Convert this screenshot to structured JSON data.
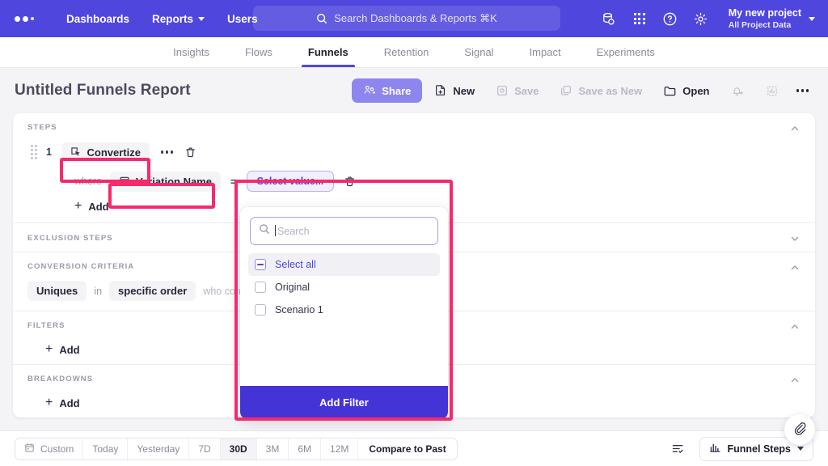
{
  "header": {
    "nav": [
      {
        "label": "Dashboards",
        "caret": false
      },
      {
        "label": "Reports",
        "caret": true
      },
      {
        "label": "Users",
        "caret": false
      }
    ],
    "search_placeholder": "Search Dashboards & Reports ⌘K",
    "icons": [
      "database-icon",
      "apps-grid-icon",
      "help-circle-icon",
      "gear-icon"
    ],
    "project_name": "My new project",
    "project_sub": "All Project Data"
  },
  "subtabs": [
    {
      "label": "Insights",
      "active": false
    },
    {
      "label": "Flows",
      "active": false
    },
    {
      "label": "Funnels",
      "active": true
    },
    {
      "label": "Retention",
      "active": false
    },
    {
      "label": "Signal",
      "active": false
    },
    {
      "label": "Impact",
      "active": false
    },
    {
      "label": "Experiments",
      "active": false
    }
  ],
  "title": {
    "text": "Untitled Funnels Report",
    "actions": {
      "share": "Share",
      "new": "New",
      "save": "Save",
      "save_as_new": "Save as New",
      "open": "Open"
    }
  },
  "panel": {
    "steps": {
      "label": "STEPS",
      "step_number": "1",
      "event_chip": "Convertize",
      "where_label": "where",
      "property_chip": "Variation Name",
      "operator": "=",
      "select_value": "Select value...",
      "add_label": "Add"
    },
    "exclusion_steps": {
      "label": "EXCLUSION STEPS"
    },
    "conversion_criteria": {
      "label": "CONVERSION CRITERIA",
      "counting": "Uniques",
      "in_word": "in",
      "order": "specific order",
      "tail": "who converted within"
    },
    "filters": {
      "label": "FILTERS",
      "add_label": "Add"
    },
    "breakdowns": {
      "label": "BREAKDOWNS",
      "add_label": "Add"
    }
  },
  "popup": {
    "search_placeholder": "Search",
    "select_all": "Select all",
    "options": [
      {
        "label": "Original",
        "checked": false
      },
      {
        "label": "Scenario 1",
        "checked": false
      }
    ],
    "add_filter": "Add Filter"
  },
  "bottombar": {
    "ranges": [
      {
        "label": "Custom",
        "active": false,
        "icon": "calendar-icon"
      },
      {
        "label": "Today",
        "active": false
      },
      {
        "label": "Yesterday",
        "active": false
      },
      {
        "label": "7D",
        "active": false
      },
      {
        "label": "30D",
        "active": true
      },
      {
        "label": "3M",
        "active": false
      },
      {
        "label": "6M",
        "active": false
      },
      {
        "label": "12M",
        "active": false
      },
      {
        "label": "Compare to Past",
        "active": false,
        "strong": true
      }
    ],
    "chart_type": "Funnel Steps"
  },
  "colors": {
    "brand": "#4f46dd",
    "brand_dark": "#4434d6",
    "highlight": "#f7296a",
    "page_bg": "#f4f4f7"
  }
}
